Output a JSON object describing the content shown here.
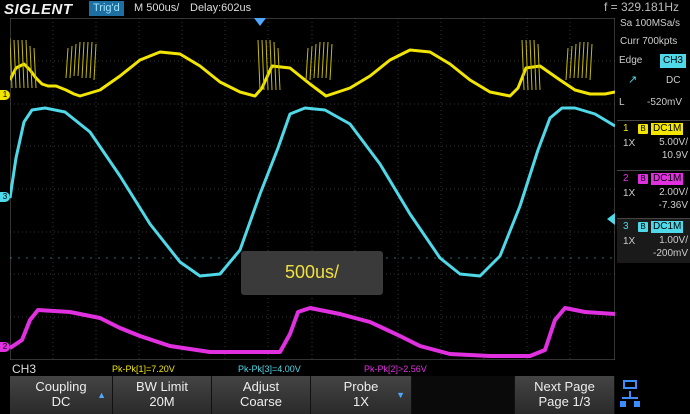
{
  "header": {
    "logo": "SIGLENT",
    "trigger_status": "Trig'd",
    "timebase": "M 500us/",
    "delay": "Delay:602us",
    "frequency": "f = 329.181Hz"
  },
  "acquisition": {
    "sample_rate": "Sa 100MSa/s",
    "memory": "Curr 700kpts"
  },
  "trigger": {
    "type": "Edge",
    "source": "CH3",
    "coupling": "DC",
    "level_label": "L",
    "level": "-520mV"
  },
  "channels": [
    {
      "num": "1",
      "bw": "B",
      "coupling": "DC1M",
      "probe": "1X",
      "scale": "5.00V/",
      "offset": "10.9V",
      "color": "#f2e600"
    },
    {
      "num": "2",
      "bw": "B",
      "coupling": "DC1M",
      "probe": "1X",
      "scale": "2.00V/",
      "offset": "-7.36V",
      "color": "#e030e0"
    },
    {
      "num": "3",
      "bw": "B",
      "coupling": "DC1M",
      "probe": "1X",
      "scale": "1.00V/",
      "offset": "-200mV",
      "color": "#4fd8e8"
    }
  ],
  "measurements": {
    "selected_channel": "CH3",
    "m1": "Pk-Pk[1]=7.20V",
    "m3": "Pk-Pk[3]=4.00V",
    "m2": "Pk-Pk[2]>2.56V"
  },
  "timebase_popup": "500us/",
  "menu": {
    "coupling_label": "Coupling",
    "coupling_value": "DC",
    "bw_label": "BW Limit",
    "bw_value": "20M",
    "adjust_label": "Adjust",
    "adjust_value": "Coarse",
    "probe_label": "Probe",
    "probe_value": "1X",
    "next_label": "Next Page",
    "next_value": "Page 1/3"
  },
  "markers": {
    "ch1": "1",
    "ch2": "2",
    "ch3": "3"
  },
  "colors": {
    "ch1": "#f2e600",
    "ch2": "#e030e0",
    "ch3": "#4fd8e8",
    "accent": "#1c6fa0"
  }
}
